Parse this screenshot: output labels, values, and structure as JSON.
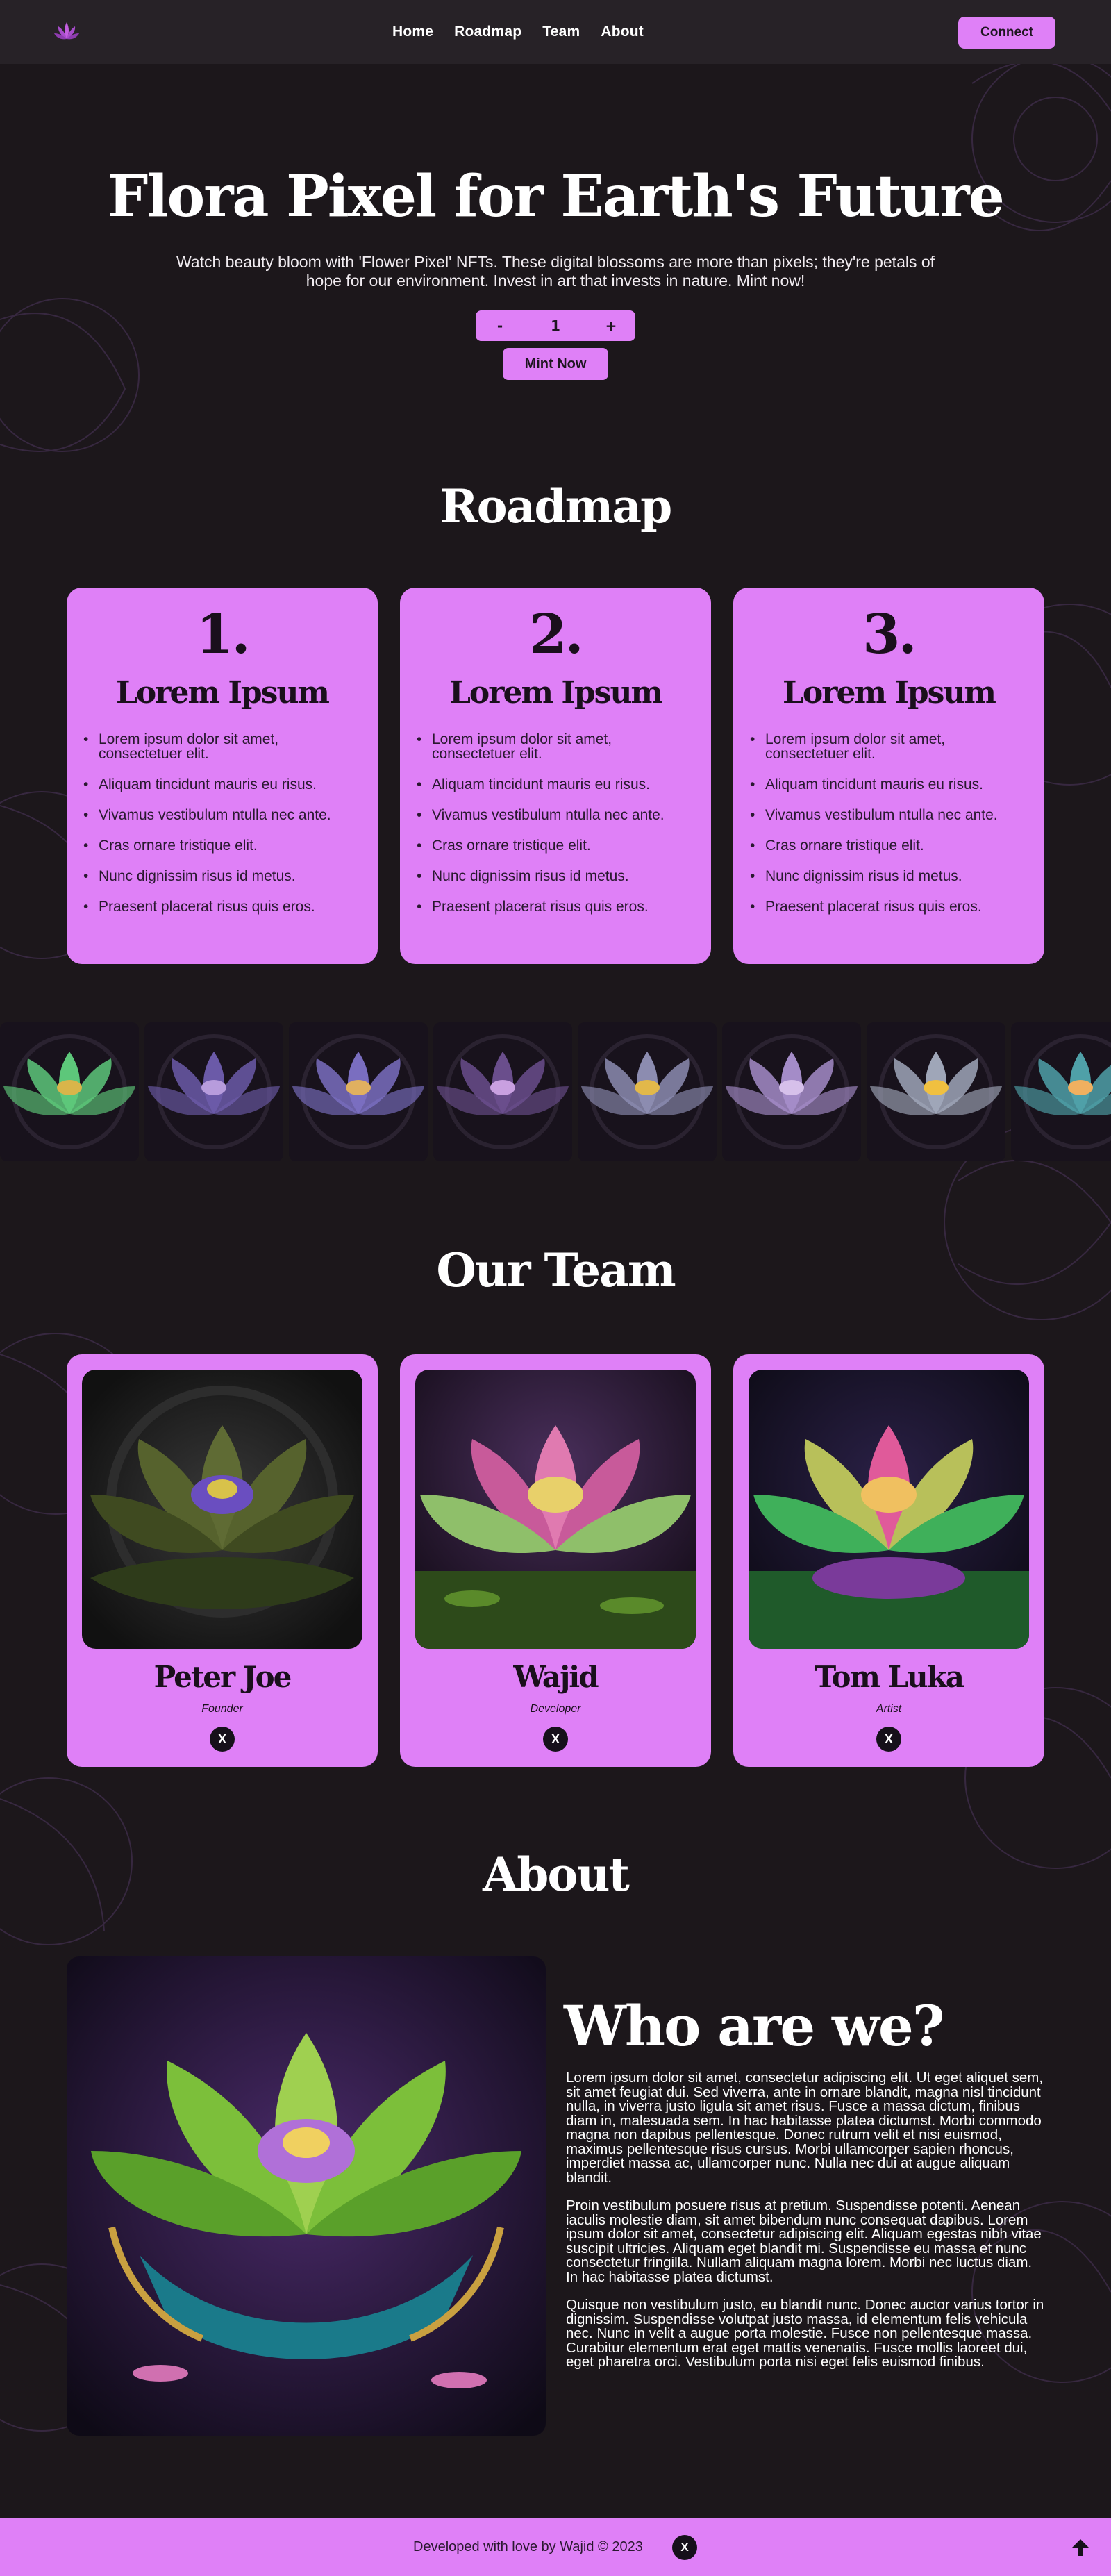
{
  "nav": {
    "links": [
      "Home",
      "Roadmap",
      "Team",
      "About"
    ],
    "connect_label": "Connect"
  },
  "hero": {
    "title": "Flora Pixel for Earth's Future",
    "subtitle": "Watch beauty bloom with 'Flower Pixel' NFTs. These digital blossoms are more than pixels; they're petals of hope for our environment. Invest in art that invests in nature. Mint now!",
    "decrement_label": "-",
    "quantity": "1",
    "increment_label": "+",
    "mint_label": "Mint Now"
  },
  "roadmap": {
    "title": "Roadmap",
    "cards": [
      {
        "number": "1.",
        "heading": "Lorem Ipsum",
        "items": [
          "Lorem ipsum dolor sit amet, consectetuer elit.",
          "Aliquam tincidunt mauris eu risus.",
          "Vivamus vestibulum ntulla nec ante.",
          "Cras ornare tristique elit.",
          "Nunc dignissim risus id metus.",
          "Praesent placerat risus quis eros."
        ]
      },
      {
        "number": "2.",
        "heading": "Lorem Ipsum",
        "items": [
          "Lorem ipsum dolor sit amet, consectetuer elit.",
          "Aliquam tincidunt mauris eu risus.",
          "Vivamus vestibulum ntulla nec ante.",
          "Cras ornare tristique elit.",
          "Nunc dignissim risus id metus.",
          "Praesent placerat risus quis eros."
        ]
      },
      {
        "number": "3.",
        "heading": "Lorem Ipsum",
        "items": [
          "Lorem ipsum dolor sit amet, consectetuer elit.",
          "Aliquam tincidunt mauris eu risus.",
          "Vivamus vestibulum ntulla nec ante.",
          "Cras ornare tristique elit.",
          "Nunc dignissim risus id metus.",
          "Praesent placerat risus quis eros."
        ]
      }
    ]
  },
  "gallery": {
    "tiles": [
      {
        "icon": "lotus-nft-image",
        "petal": "#5dc77a",
        "core": "#d9b54a"
      },
      {
        "icon": "lotus-nft-image",
        "petal": "#6b5aa8",
        "core": "#b79cdc"
      },
      {
        "icon": "lotus-nft-image",
        "petal": "#7a6ec0",
        "core": "#e0b060"
      },
      {
        "icon": "lotus-nft-image",
        "petal": "#6a4e8c",
        "core": "#c9a0e0"
      },
      {
        "icon": "lotus-nft-image",
        "petal": "#8c8cb0",
        "core": "#e2b84a"
      },
      {
        "icon": "lotus-nft-image",
        "petal": "#a48cc8",
        "core": "#d6c0ea"
      },
      {
        "icon": "lotus-nft-image",
        "petal": "#9fa6b8",
        "core": "#f0c040"
      },
      {
        "icon": "lotus-nft-image",
        "petal": "#4fa0a8",
        "core": "#f0b060"
      }
    ]
  },
  "team": {
    "title": "Our Team",
    "members": [
      {
        "name": "Peter Joe",
        "role": "Founder",
        "x_icon": "x-logo-icon"
      },
      {
        "name": "Wajid",
        "role": "Developer",
        "x_icon": "x-logo-icon"
      },
      {
        "name": "Tom Luka",
        "role": "Artist",
        "x_icon": "x-logo-icon"
      }
    ]
  },
  "about": {
    "title": "About",
    "heading": "Who are we?",
    "paragraphs": [
      "Lorem ipsum dolor sit amet, consectetur adipiscing elit. Ut eget aliquet sem, sit amet feugiat dui. Sed viverra, ante in ornare blandit, magna nisl tincidunt nulla, in viverra justo ligula sit amet risus. Fusce a massa dictum, finibus diam in, malesuada sem. In hac habitasse platea dictumst. Morbi commodo magna non dapibus pellentesque. Donec rutrum velit et nisi euismod, maximus pellentesque risus cursus. Morbi ullamcorper sapien rhoncus, imperdiet massa ac, ullamcorper nunc. Nulla nec dui at augue aliquam blandit.",
      "Proin vestibulum posuere risus at pretium. Suspendisse potenti. Aenean iaculis molestie diam, sit amet bibendum nunc consequat dapibus. Lorem ipsum dolor sit amet, consectetur adipiscing elit. Aliquam egestas nibh vitae suscipit ultricies. Aliquam eget blandit mi. Suspendisse eu massa et nunc consectetur fringilla. Nullam aliquam magna lorem. Morbi nec luctus diam. In hac habitasse platea dictumst.",
      "Quisque non vestibulum justo, eu blandit nunc. Donec auctor varius tortor in dignissim. Suspendisse volutpat justo massa, id elementum felis vehicula nec. Nunc in velit a augue porta molestie. Fusce non pellentesque massa. Curabitur elementum erat eget mattis venenatis. Fusce mollis laoreet dui, eget pharetra orci. Vestibulum porta nisi eget felis euismod finibus."
    ]
  },
  "footer": {
    "credit": "Developed with love by Wajid © 2023",
    "x_icon": "x-logo-icon",
    "scroll_top_icon": "arrow-up-icon"
  },
  "colors": {
    "accent": "#df80f7",
    "background": "#1c171b",
    "nav_background": "#272227"
  }
}
